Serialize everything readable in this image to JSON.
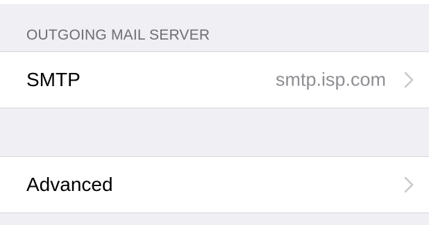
{
  "section": {
    "header": "OUTGOING MAIL SERVER"
  },
  "rows": {
    "smtp": {
      "label": "SMTP",
      "value": "smtp.isp.com",
      "icon": "chevron-right-icon"
    },
    "advanced": {
      "label": "Advanced",
      "icon": "chevron-right-icon"
    }
  },
  "colors": {
    "background": "#efeff4",
    "cell": "#ffffff",
    "separator": "#d7d7dc",
    "secondary_text": "#8e8e93",
    "chevron": "#c7c7cc"
  }
}
